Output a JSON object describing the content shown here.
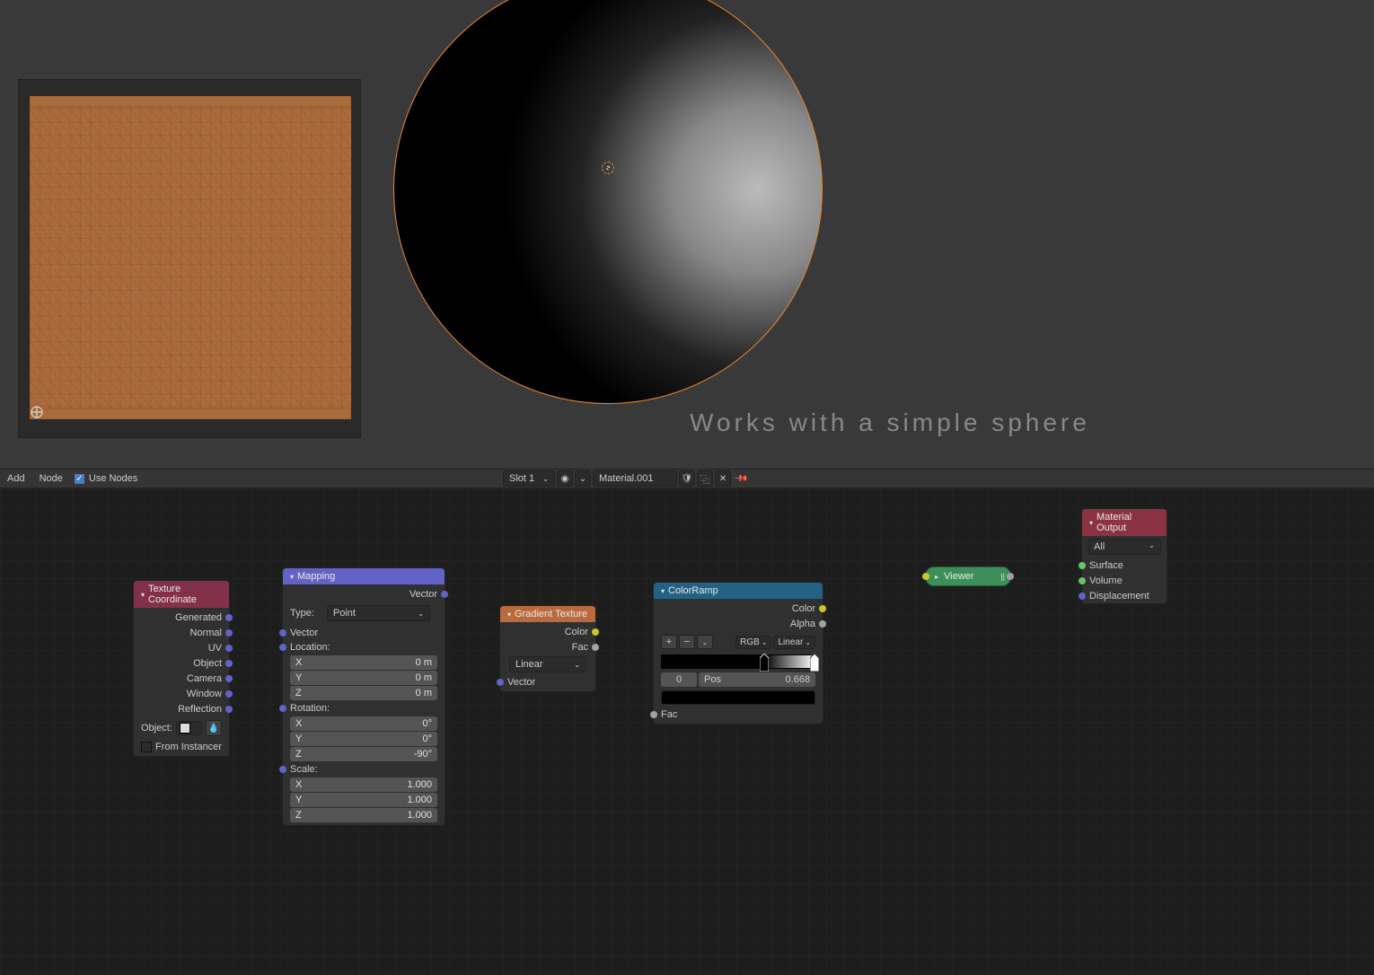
{
  "annotation": "Works with a simple sphere",
  "header": {
    "add": "Add",
    "node": "Node",
    "use_nodes": "Use Nodes",
    "slot": "Slot 1",
    "material": "Material.001"
  },
  "nodes": {
    "texcoord": {
      "title": "Texture Coordinate",
      "outputs": [
        "Generated",
        "Normal",
        "UV",
        "Object",
        "Camera",
        "Window",
        "Reflection"
      ],
      "object_label": "Object:",
      "from_instancer": "From Instancer"
    },
    "mapping": {
      "title": "Mapping",
      "vector_out": "Vector",
      "type_label": "Type:",
      "type_value": "Point",
      "vector_in": "Vector",
      "location_label": "Location:",
      "location": {
        "x": "X",
        "y": "Y",
        "z": "Z",
        "xv": "0 m",
        "yv": "0 m",
        "zv": "0 m"
      },
      "rotation_label": "Rotation:",
      "rotation": {
        "xv": "0°",
        "yv": "0°",
        "zv": "-90°"
      },
      "scale_label": "Scale:",
      "scale": {
        "xv": "1.000",
        "yv": "1.000",
        "zv": "1.000"
      }
    },
    "gradient": {
      "title": "Gradient Texture",
      "color_out": "Color",
      "fac_out": "Fac",
      "type": "Linear",
      "vector_in": "Vector"
    },
    "colorramp": {
      "title": "ColorRamp",
      "color_out": "Color",
      "alpha_out": "Alpha",
      "mode": "RGB",
      "interp": "Linear",
      "idx": "0",
      "pos_label": "Pos",
      "pos_value": "0.668",
      "fac_in": "Fac"
    },
    "viewer": {
      "title": "Viewer"
    },
    "matout": {
      "title": "Material Output",
      "target": "All",
      "surface": "Surface",
      "volume": "Volume",
      "displacement": "Displacement"
    }
  }
}
